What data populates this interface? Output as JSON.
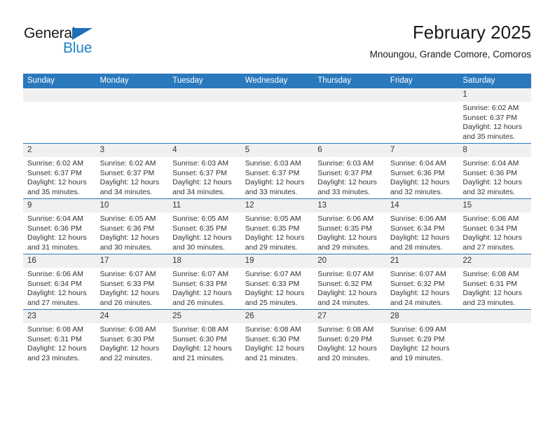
{
  "logo": {
    "word1": "General",
    "word2": "Blue",
    "triangle_color": "#1c6fb8",
    "blue_color": "#2083c7"
  },
  "header": {
    "title": "February 2025",
    "subtitle": "Mnoungou, Grande Comore, Comoros"
  },
  "colors": {
    "header_blue": "#2b79bd",
    "daynum_band": "#f0f0f0",
    "text": "#333333"
  },
  "weekdays": [
    "Sunday",
    "Monday",
    "Tuesday",
    "Wednesday",
    "Thursday",
    "Friday",
    "Saturday"
  ],
  "weeks": [
    [
      {
        "day": "",
        "sunrise": "",
        "sunset": "",
        "daylight1": "",
        "daylight2": "",
        "empty": true
      },
      {
        "day": "",
        "sunrise": "",
        "sunset": "",
        "daylight1": "",
        "daylight2": "",
        "empty": true
      },
      {
        "day": "",
        "sunrise": "",
        "sunset": "",
        "daylight1": "",
        "daylight2": "",
        "empty": true
      },
      {
        "day": "",
        "sunrise": "",
        "sunset": "",
        "daylight1": "",
        "daylight2": "",
        "empty": true
      },
      {
        "day": "",
        "sunrise": "",
        "sunset": "",
        "daylight1": "",
        "daylight2": "",
        "empty": true
      },
      {
        "day": "",
        "sunrise": "",
        "sunset": "",
        "daylight1": "",
        "daylight2": "",
        "empty": true
      },
      {
        "day": "1",
        "sunrise": "Sunrise: 6:02 AM",
        "sunset": "Sunset: 6:37 PM",
        "daylight1": "Daylight: 12 hours",
        "daylight2": "and 35 minutes."
      }
    ],
    [
      {
        "day": "2",
        "sunrise": "Sunrise: 6:02 AM",
        "sunset": "Sunset: 6:37 PM",
        "daylight1": "Daylight: 12 hours",
        "daylight2": "and 35 minutes."
      },
      {
        "day": "3",
        "sunrise": "Sunrise: 6:02 AM",
        "sunset": "Sunset: 6:37 PM",
        "daylight1": "Daylight: 12 hours",
        "daylight2": "and 34 minutes."
      },
      {
        "day": "4",
        "sunrise": "Sunrise: 6:03 AM",
        "sunset": "Sunset: 6:37 PM",
        "daylight1": "Daylight: 12 hours",
        "daylight2": "and 34 minutes."
      },
      {
        "day": "5",
        "sunrise": "Sunrise: 6:03 AM",
        "sunset": "Sunset: 6:37 PM",
        "daylight1": "Daylight: 12 hours",
        "daylight2": "and 33 minutes."
      },
      {
        "day": "6",
        "sunrise": "Sunrise: 6:03 AM",
        "sunset": "Sunset: 6:37 PM",
        "daylight1": "Daylight: 12 hours",
        "daylight2": "and 33 minutes."
      },
      {
        "day": "7",
        "sunrise": "Sunrise: 6:04 AM",
        "sunset": "Sunset: 6:36 PM",
        "daylight1": "Daylight: 12 hours",
        "daylight2": "and 32 minutes."
      },
      {
        "day": "8",
        "sunrise": "Sunrise: 6:04 AM",
        "sunset": "Sunset: 6:36 PM",
        "daylight1": "Daylight: 12 hours",
        "daylight2": "and 32 minutes."
      }
    ],
    [
      {
        "day": "9",
        "sunrise": "Sunrise: 6:04 AM",
        "sunset": "Sunset: 6:36 PM",
        "daylight1": "Daylight: 12 hours",
        "daylight2": "and 31 minutes."
      },
      {
        "day": "10",
        "sunrise": "Sunrise: 6:05 AM",
        "sunset": "Sunset: 6:36 PM",
        "daylight1": "Daylight: 12 hours",
        "daylight2": "and 30 minutes."
      },
      {
        "day": "11",
        "sunrise": "Sunrise: 6:05 AM",
        "sunset": "Sunset: 6:35 PM",
        "daylight1": "Daylight: 12 hours",
        "daylight2": "and 30 minutes."
      },
      {
        "day": "12",
        "sunrise": "Sunrise: 6:05 AM",
        "sunset": "Sunset: 6:35 PM",
        "daylight1": "Daylight: 12 hours",
        "daylight2": "and 29 minutes."
      },
      {
        "day": "13",
        "sunrise": "Sunrise: 6:06 AM",
        "sunset": "Sunset: 6:35 PM",
        "daylight1": "Daylight: 12 hours",
        "daylight2": "and 29 minutes."
      },
      {
        "day": "14",
        "sunrise": "Sunrise: 6:06 AM",
        "sunset": "Sunset: 6:34 PM",
        "daylight1": "Daylight: 12 hours",
        "daylight2": "and 28 minutes."
      },
      {
        "day": "15",
        "sunrise": "Sunrise: 6:06 AM",
        "sunset": "Sunset: 6:34 PM",
        "daylight1": "Daylight: 12 hours",
        "daylight2": "and 27 minutes."
      }
    ],
    [
      {
        "day": "16",
        "sunrise": "Sunrise: 6:06 AM",
        "sunset": "Sunset: 6:34 PM",
        "daylight1": "Daylight: 12 hours",
        "daylight2": "and 27 minutes."
      },
      {
        "day": "17",
        "sunrise": "Sunrise: 6:07 AM",
        "sunset": "Sunset: 6:33 PM",
        "daylight1": "Daylight: 12 hours",
        "daylight2": "and 26 minutes."
      },
      {
        "day": "18",
        "sunrise": "Sunrise: 6:07 AM",
        "sunset": "Sunset: 6:33 PM",
        "daylight1": "Daylight: 12 hours",
        "daylight2": "and 26 minutes."
      },
      {
        "day": "19",
        "sunrise": "Sunrise: 6:07 AM",
        "sunset": "Sunset: 6:33 PM",
        "daylight1": "Daylight: 12 hours",
        "daylight2": "and 25 minutes."
      },
      {
        "day": "20",
        "sunrise": "Sunrise: 6:07 AM",
        "sunset": "Sunset: 6:32 PM",
        "daylight1": "Daylight: 12 hours",
        "daylight2": "and 24 minutes."
      },
      {
        "day": "21",
        "sunrise": "Sunrise: 6:07 AM",
        "sunset": "Sunset: 6:32 PM",
        "daylight1": "Daylight: 12 hours",
        "daylight2": "and 24 minutes."
      },
      {
        "day": "22",
        "sunrise": "Sunrise: 6:08 AM",
        "sunset": "Sunset: 6:31 PM",
        "daylight1": "Daylight: 12 hours",
        "daylight2": "and 23 minutes."
      }
    ],
    [
      {
        "day": "23",
        "sunrise": "Sunrise: 6:08 AM",
        "sunset": "Sunset: 6:31 PM",
        "daylight1": "Daylight: 12 hours",
        "daylight2": "and 23 minutes."
      },
      {
        "day": "24",
        "sunrise": "Sunrise: 6:08 AM",
        "sunset": "Sunset: 6:30 PM",
        "daylight1": "Daylight: 12 hours",
        "daylight2": "and 22 minutes."
      },
      {
        "day": "25",
        "sunrise": "Sunrise: 6:08 AM",
        "sunset": "Sunset: 6:30 PM",
        "daylight1": "Daylight: 12 hours",
        "daylight2": "and 21 minutes."
      },
      {
        "day": "26",
        "sunrise": "Sunrise: 6:08 AM",
        "sunset": "Sunset: 6:30 PM",
        "daylight1": "Daylight: 12 hours",
        "daylight2": "and 21 minutes."
      },
      {
        "day": "27",
        "sunrise": "Sunrise: 6:08 AM",
        "sunset": "Sunset: 6:29 PM",
        "daylight1": "Daylight: 12 hours",
        "daylight2": "and 20 minutes."
      },
      {
        "day": "28",
        "sunrise": "Sunrise: 6:09 AM",
        "sunset": "Sunset: 6:29 PM",
        "daylight1": "Daylight: 12 hours",
        "daylight2": "and 19 minutes."
      },
      {
        "day": "",
        "sunrise": "",
        "sunset": "",
        "daylight1": "",
        "daylight2": "",
        "empty": true
      }
    ]
  ]
}
